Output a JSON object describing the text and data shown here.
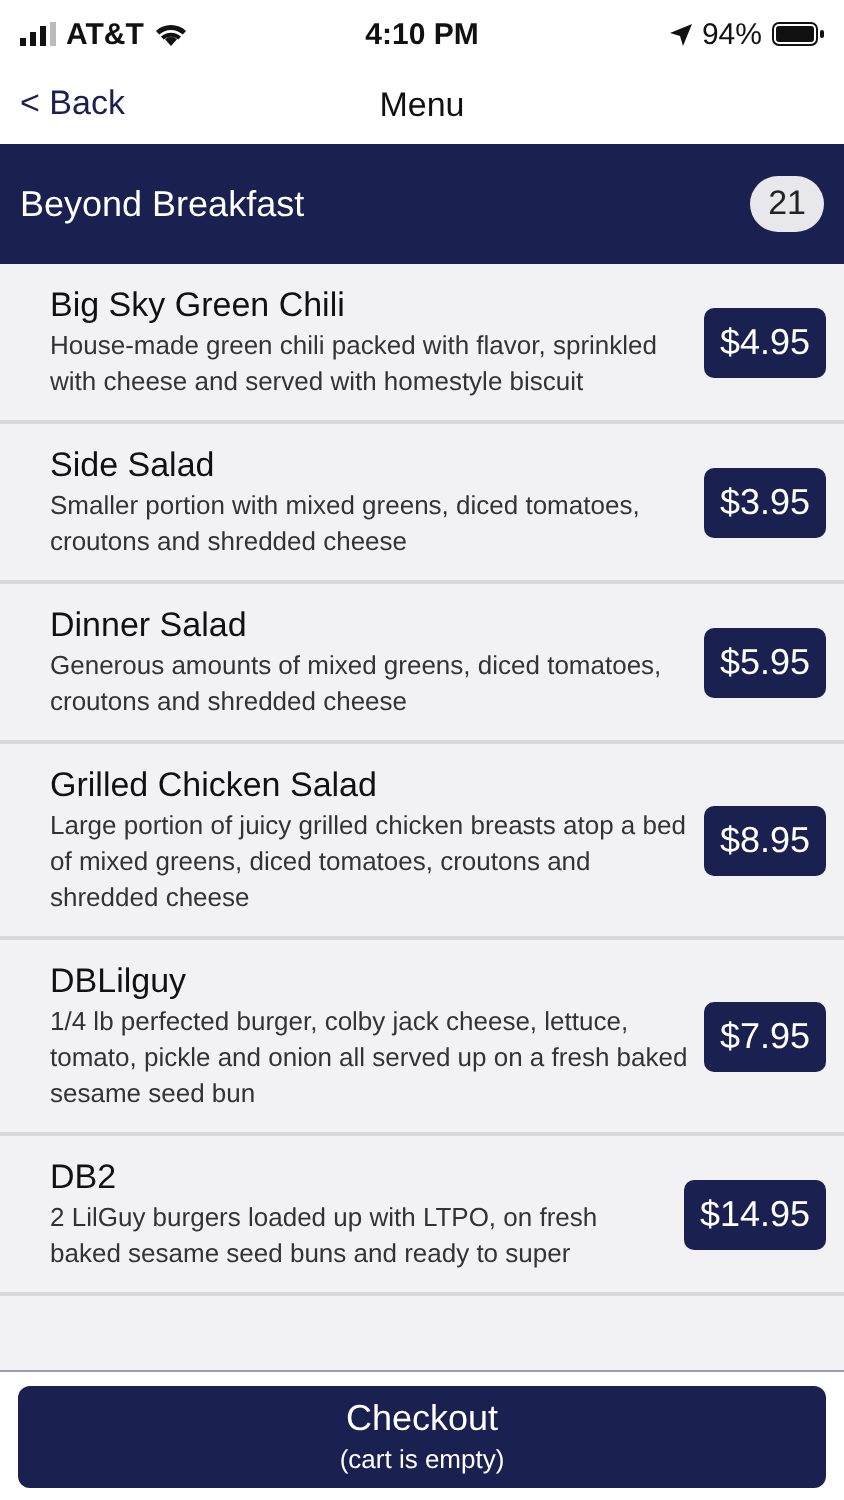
{
  "status_bar": {
    "carrier": "AT&T",
    "time": "4:10 PM",
    "battery": "94%"
  },
  "nav": {
    "back": "< Back",
    "title": "Menu"
  },
  "section": {
    "title": "Beyond Breakfast",
    "count": "21"
  },
  "items": [
    {
      "name": "Big Sky Green Chili",
      "description": "House-made green chili packed with flavor, sprinkled with cheese and served with homestyle biscuit",
      "price": "$4.95"
    },
    {
      "name": "Side Salad",
      "description": "Smaller portion with mixed greens, diced tomatoes, croutons and shredded cheese",
      "price": "$3.95"
    },
    {
      "name": "Dinner Salad",
      "description": "Generous amounts of mixed greens, diced tomatoes, croutons and shredded cheese",
      "price": "$5.95"
    },
    {
      "name": "Grilled Chicken Salad",
      "description": "Large portion of juicy grilled chicken breasts atop a bed of mixed greens, diced tomatoes, croutons and shredded cheese",
      "price": "$8.95"
    },
    {
      "name": "DBLilguy",
      "description": "1/4 lb perfected burger, colby jack cheese, lettuce, tomato, pickle and onion all served up on a fresh baked sesame seed bun",
      "price": "$7.95"
    },
    {
      "name": "DB2",
      "description": "2 LilGuy burgers loaded up with LTPO, on fresh baked sesame seed buns and ready to super",
      "price": "$14.95"
    }
  ],
  "checkout": {
    "label": "Checkout",
    "note": "(cart is empty)"
  }
}
